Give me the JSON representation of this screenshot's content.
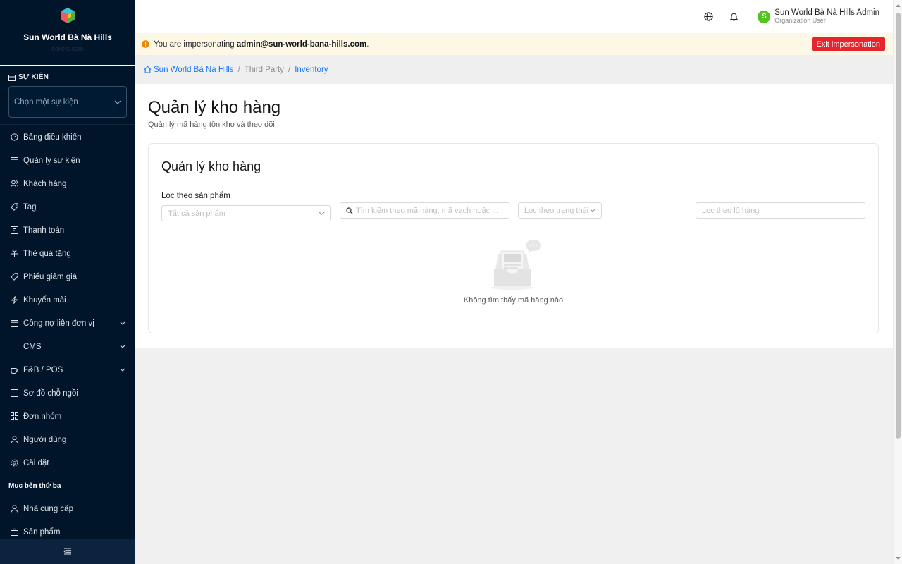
{
  "sidebar": {
    "brand_name": "Sun World Bà Nà Hills",
    "brand_sub": "tickets.com",
    "event_section_title": "SỰ KIỆN",
    "event_select_placeholder": "Chọn một sự kiện",
    "menu": [
      {
        "label": "Bảng điều khiển",
        "icon": "dashboard-icon"
      },
      {
        "label": "Quản lý sự kiện",
        "icon": "calendar-icon"
      },
      {
        "label": "Khách hàng",
        "icon": "users-icon"
      },
      {
        "label": "Tag",
        "icon": "tag-icon"
      },
      {
        "label": "Thanh toán",
        "icon": "payment-icon"
      },
      {
        "label": "Thẻ quà tặng",
        "icon": "gift-icon"
      },
      {
        "label": "Phiếu giảm giá",
        "icon": "coupon-icon"
      },
      {
        "label": "Khuyến mãi",
        "icon": "flash-icon"
      },
      {
        "label": "Công nợ liên đơn vị",
        "icon": "calendar-icon",
        "expandable": true
      },
      {
        "label": "CMS",
        "icon": "cms-icon",
        "expandable": true
      },
      {
        "label": "F&B / POS",
        "icon": "coffee-icon",
        "expandable": true
      },
      {
        "label": "Sơ đồ chỗ ngồi",
        "icon": "layout-icon"
      },
      {
        "label": "Đơn nhóm",
        "icon": "grid-icon"
      },
      {
        "label": "Người dùng",
        "icon": "user-icon"
      },
      {
        "label": "Cài đặt",
        "icon": "gear-icon"
      }
    ],
    "third_party_title": "Mục bên thứ ba",
    "third_party_menu": [
      {
        "label": "Nhà cung cấp",
        "icon": "user-icon"
      },
      {
        "label": "Sản phẩm",
        "icon": "shopping-bag-icon"
      }
    ]
  },
  "header": {
    "user_initial": "S",
    "user_name": "Sun World Bà Nà Hills Admin",
    "user_role": "Organization User"
  },
  "banner": {
    "prefix": "You are impersonating ",
    "email": "admin@sun-world-bana-hills.com",
    "suffix": ".",
    "exit_label": "Exit impersonation"
  },
  "breadcrumb": {
    "home": "Sun World Bà Nà Hills",
    "middle": "Third Party",
    "current": "Inventory"
  },
  "page": {
    "title": "Quản lý kho hàng",
    "subtitle": "Quản lý mã hàng tồn kho và theo dõi"
  },
  "card": {
    "title": "Quản lý kho hàng",
    "filter_label": "Lọc theo sản phẩm",
    "product_placeholder": "Tất cả sản phẩm",
    "search_placeholder": "Tìm kiếm theo mã hàng, mã vạch hoặc ...",
    "status_placeholder": "Lọc theo trạng thái",
    "batch_placeholder": "Lọc theo lô hàng",
    "empty_text": "Không tìm thấy mã hàng nào"
  },
  "colors": {
    "sidebar_bg": "#001529",
    "accent": "#1677ff",
    "exit_button": "#e5242b",
    "avatar": "#52c41a"
  }
}
